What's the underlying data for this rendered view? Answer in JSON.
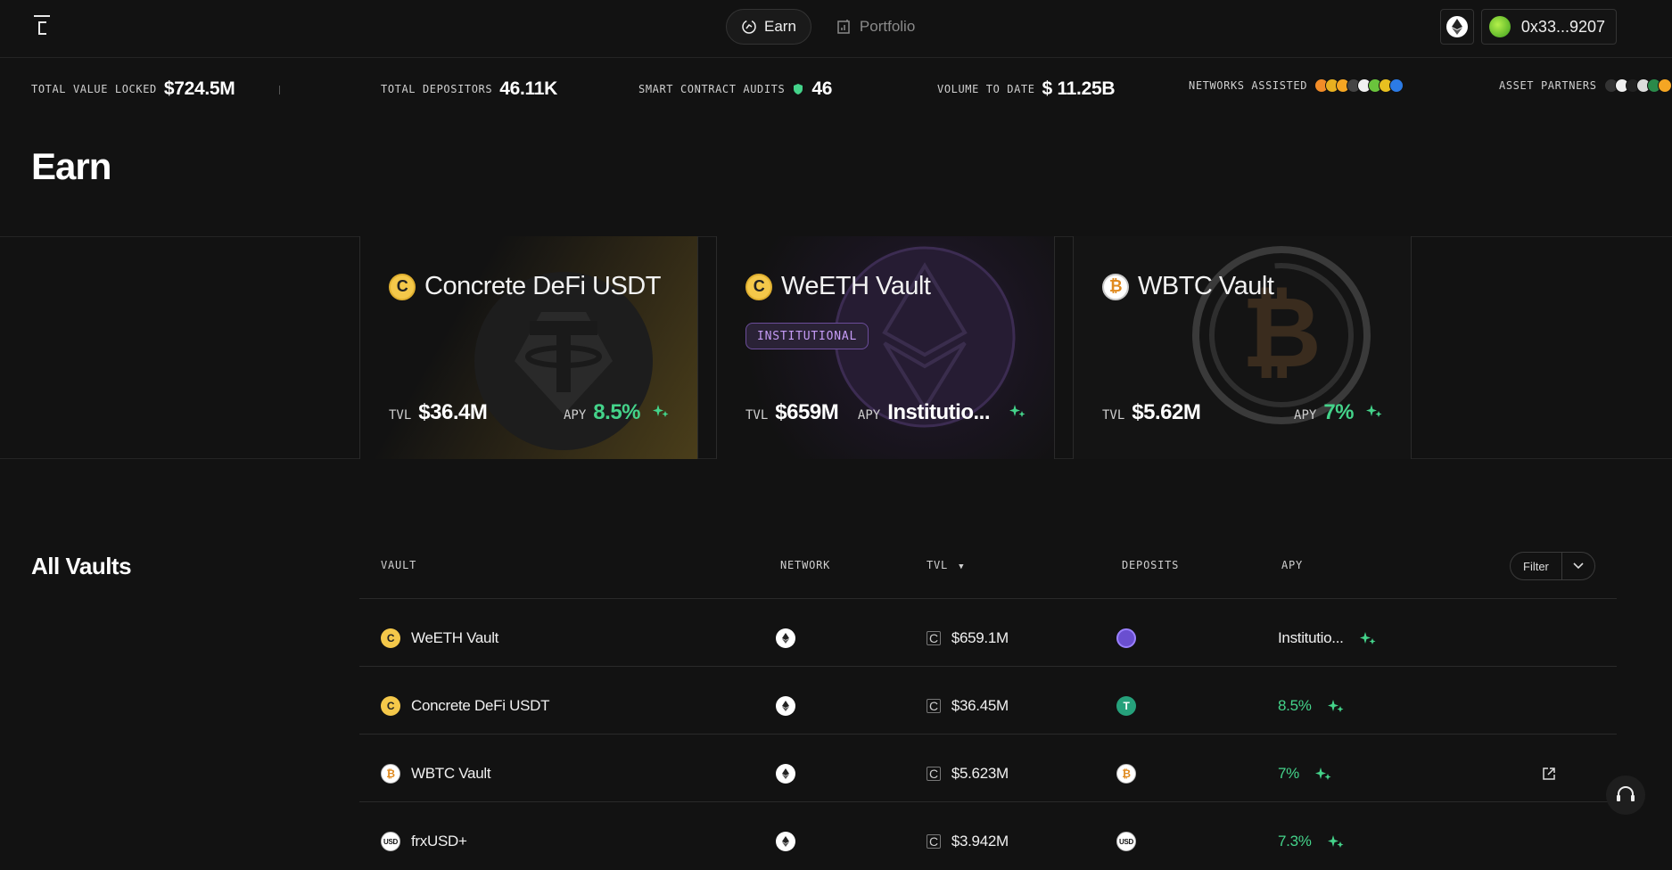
{
  "nav": {
    "earn_label": "Earn",
    "portfolio_label": "Portfolio"
  },
  "wallet": {
    "address": "0x33...9207"
  },
  "stats": {
    "tvl_label": "TOTAL VALUE LOCKED",
    "tvl_value": "$724.5M",
    "depositors_label": "TOTAL DEPOSITORS",
    "depositors_value": "46.11K",
    "audits_label": "SMART CONTRACT AUDITS",
    "audits_value": "46",
    "volume_label": "VOLUME TO DATE",
    "volume_value": "$ 11.25B",
    "networks_label": "NETWORKS ASSISTED",
    "partners_label": "ASSET PARTNERS"
  },
  "page": {
    "title": "Earn"
  },
  "featured": [
    {
      "name": "Concrete DeFi USDT",
      "tvl_label": "TVL",
      "tvl": "$36.4M",
      "apy_label": "APY",
      "apy": "8.5%"
    },
    {
      "name": "WeETH Vault",
      "badge": "INSTITUTIONAL",
      "tvl_label": "TVL",
      "tvl": "$659M",
      "apy_label": "APY",
      "apy": "Institutio..."
    },
    {
      "name": "WBTC Vault",
      "tvl_label": "TVL",
      "tvl": "$5.62M",
      "apy_label": "APY",
      "apy": "7%"
    }
  ],
  "vaults": {
    "title": "All Vaults",
    "columns": {
      "vault": "VAULT",
      "network": "NETWORK",
      "tvl": "TVL",
      "deposits": "DEPOSITS",
      "apy": "APY"
    },
    "filter_label": "Filter",
    "rows": [
      {
        "name": "WeETH Vault",
        "tvl": "$659.1M",
        "apy": "Institutio..."
      },
      {
        "name": "Concrete DeFi USDT",
        "tvl": "$36.45M",
        "apy": "8.5%"
      },
      {
        "name": "WBTC Vault",
        "tvl": "$5.623M",
        "apy": "7%"
      },
      {
        "name": "frxUSD+",
        "tvl": "$3.942M",
        "apy": "7.3%"
      }
    ]
  },
  "colors": {
    "accent_green": "#44d38a",
    "institutional_purple": "#c59cf6",
    "concrete_yellow": "#f4c84a"
  }
}
